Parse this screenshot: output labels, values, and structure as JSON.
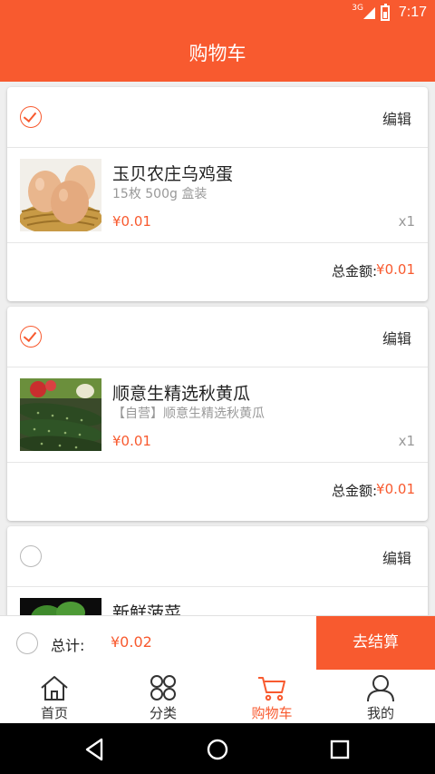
{
  "status_bar": {
    "network": "3G",
    "time": "7:17"
  },
  "header": {
    "title": "购物车"
  },
  "shops": [
    {
      "checked": true,
      "edit_label": "编辑",
      "item": {
        "name": "玉贝农庄乌鸡蛋",
        "desc": "15枚 500g 盒装",
        "price": "¥0.01",
        "qty": "x1",
        "image": "eggs-photo"
      },
      "total_label": "总金额:",
      "total_value": "¥0.01"
    },
    {
      "checked": true,
      "edit_label": "编辑",
      "item": {
        "name": "顺意生精选秋黄瓜",
        "desc": "【自营】顺意生精选秋黄瓜",
        "price": "¥0.01",
        "qty": "x1",
        "image": "cucumber-photo"
      },
      "total_label": "总金额:",
      "total_value": "¥0.01"
    },
    {
      "checked": false,
      "edit_label": "编辑",
      "item": {
        "name": "新鲜菠菜",
        "image": "spinach-photo"
      }
    }
  ],
  "checkout": {
    "select_all_checked": false,
    "sum_label": "总计:",
    "sum_value": "¥0.02",
    "button_label": "去结算"
  },
  "tabs": [
    {
      "label": "首页",
      "icon": "home-icon"
    },
    {
      "label": "分类",
      "icon": "category-icon"
    },
    {
      "label": "购物车",
      "icon": "cart-icon",
      "active": true
    },
    {
      "label": "我的",
      "icon": "user-icon"
    }
  ],
  "colors": {
    "accent": "#f85a2f",
    "background": "#efefef"
  }
}
